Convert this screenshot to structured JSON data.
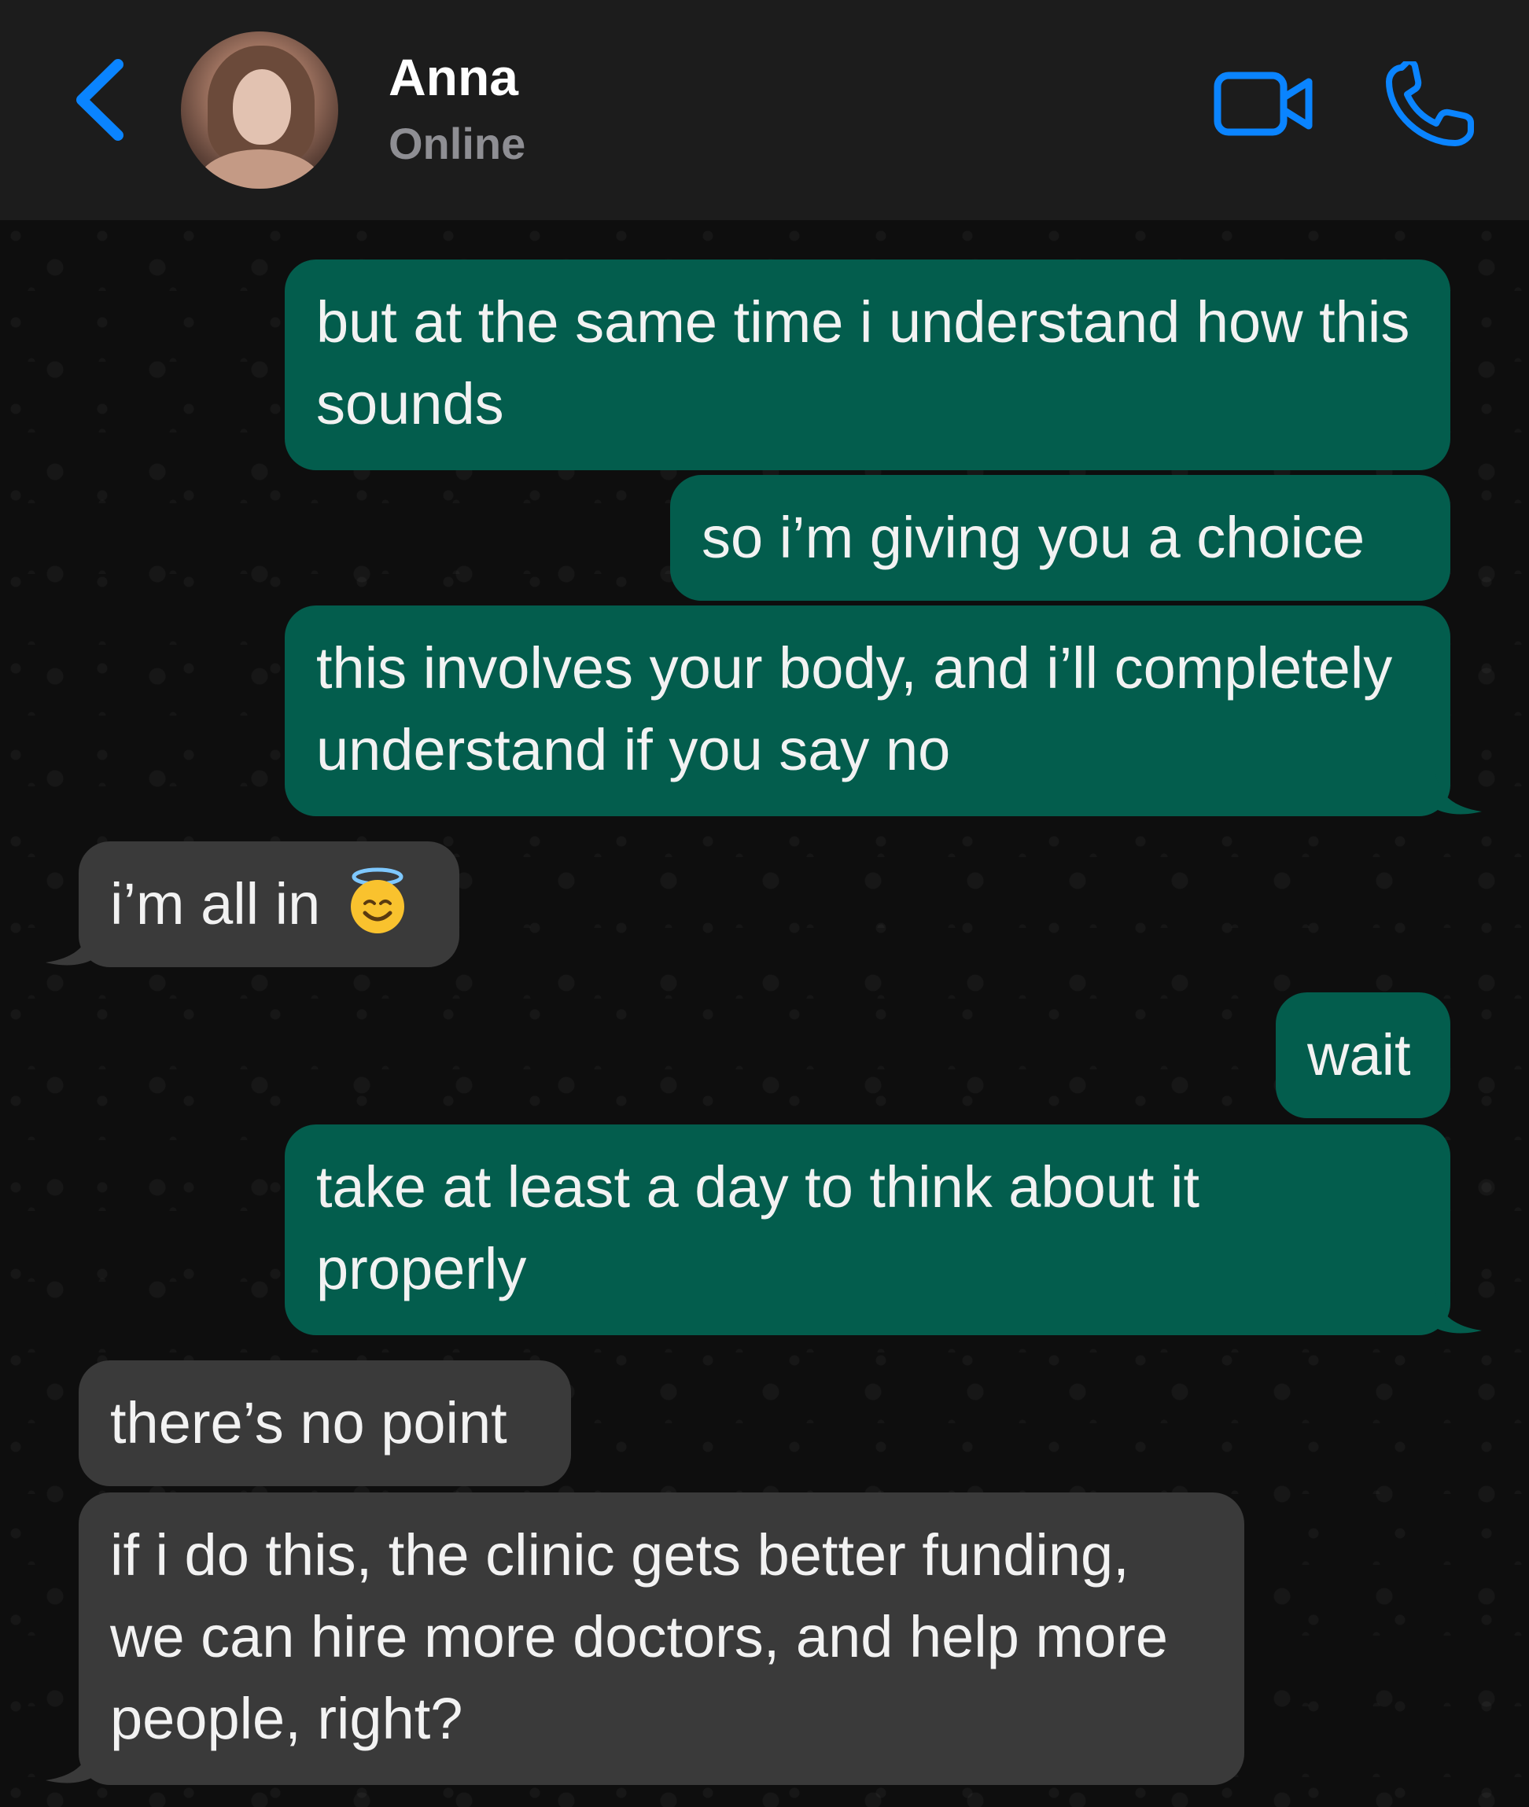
{
  "header": {
    "contact_name": "Anna",
    "status": "Online",
    "accent_color": "#0a84ff",
    "icons": [
      "chevron-left-icon",
      "video-camera-icon",
      "phone-icon"
    ]
  },
  "messages": [
    {
      "direction": "outgoing",
      "text": "but at the same time i understand how this sounds"
    },
    {
      "direction": "outgoing",
      "text": "so i’m giving you a choice"
    },
    {
      "direction": "outgoing",
      "text": "this involves your body, and i’ll completely understand if you say no"
    },
    {
      "direction": "incoming",
      "text": "i’m all in",
      "emoji": "smiling-face-with-halo"
    },
    {
      "direction": "outgoing",
      "text": "wait"
    },
    {
      "direction": "outgoing",
      "text": "take at least a day to think about it properly"
    },
    {
      "direction": "incoming",
      "text": "there’s no point"
    },
    {
      "direction": "incoming",
      "text": "if i do this, the clinic gets better funding, we can hire more doctors, and help more people, right?"
    }
  ],
  "colors": {
    "outgoing_bubble": "#035d4d",
    "incoming_bubble": "#3a3a3a",
    "header_bg": "#1c1c1c",
    "chat_bg": "#0e0e0e"
  }
}
